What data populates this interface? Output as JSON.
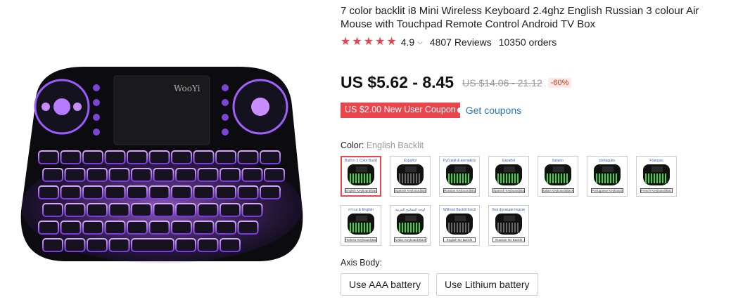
{
  "product": {
    "title": "7 color backlit i8 Mini Wireless Keyboard 2.4ghz English Russian 3 colour Air Mouse with Touchpad Remote Control Android TV Box",
    "image_brand": "WooYi"
  },
  "rating": {
    "stars": 5,
    "score": "4.9",
    "reviews": "4807 Reviews",
    "orders": "10350 orders"
  },
  "price": {
    "current": "US $5.62 - 8.45",
    "original": "US $14.06 - 21.12",
    "discount": "-60%"
  },
  "coupon": {
    "badge": "US $2.00 New User Coupon",
    "link": "Get coupons"
  },
  "color": {
    "label": "Color:",
    "selected": "English Backlit",
    "swatches": [
      {
        "top": "Built in 3 Color Backlit",
        "bottom": "English Keyboard(Backlit)",
        "style": "green",
        "selected": true
      },
      {
        "top": "Español",
        "bottom": "Spanish Keyboard(Backlit)",
        "style": "dark"
      },
      {
        "top": "Русский & английский",
        "bottom": "Russian Keyboard(Backlit)",
        "style": "green"
      },
      {
        "top": "Español",
        "bottom": "Spanish Keyboard(Backlit)",
        "style": "green"
      },
      {
        "top": "italiano",
        "bottom": "Italian Keyboard(Backlit)",
        "style": "green"
      },
      {
        "top": "português",
        "bottom": "Portuguese Keyboard(Backlit)",
        "style": "green"
      },
      {
        "top": "Français",
        "bottom": "French Keyboard(Backlit)",
        "style": "green"
      },
      {
        "top": "עברית & English",
        "bottom": "Hebrew Keyboard(Backlit)",
        "style": "green"
      },
      {
        "top": "لوحة المفاتيح العربية",
        "bottom": "Arabic Keyboard(Backlit)",
        "style": "green"
      },
      {
        "top": "Without Backlit function",
        "bottom": "English No Backlit",
        "style": "dark"
      },
      {
        "top": "Без функции подсветки",
        "bottom": "Russian No Backlit",
        "style": "dark"
      }
    ]
  },
  "axis_body": {
    "label": "Axis Body:",
    "options": [
      "Use AAA battery",
      "Use Lithium battery"
    ]
  },
  "colors": {
    "accent": "#e8454d",
    "link": "#2575c3",
    "backlight": "#a34dff"
  }
}
